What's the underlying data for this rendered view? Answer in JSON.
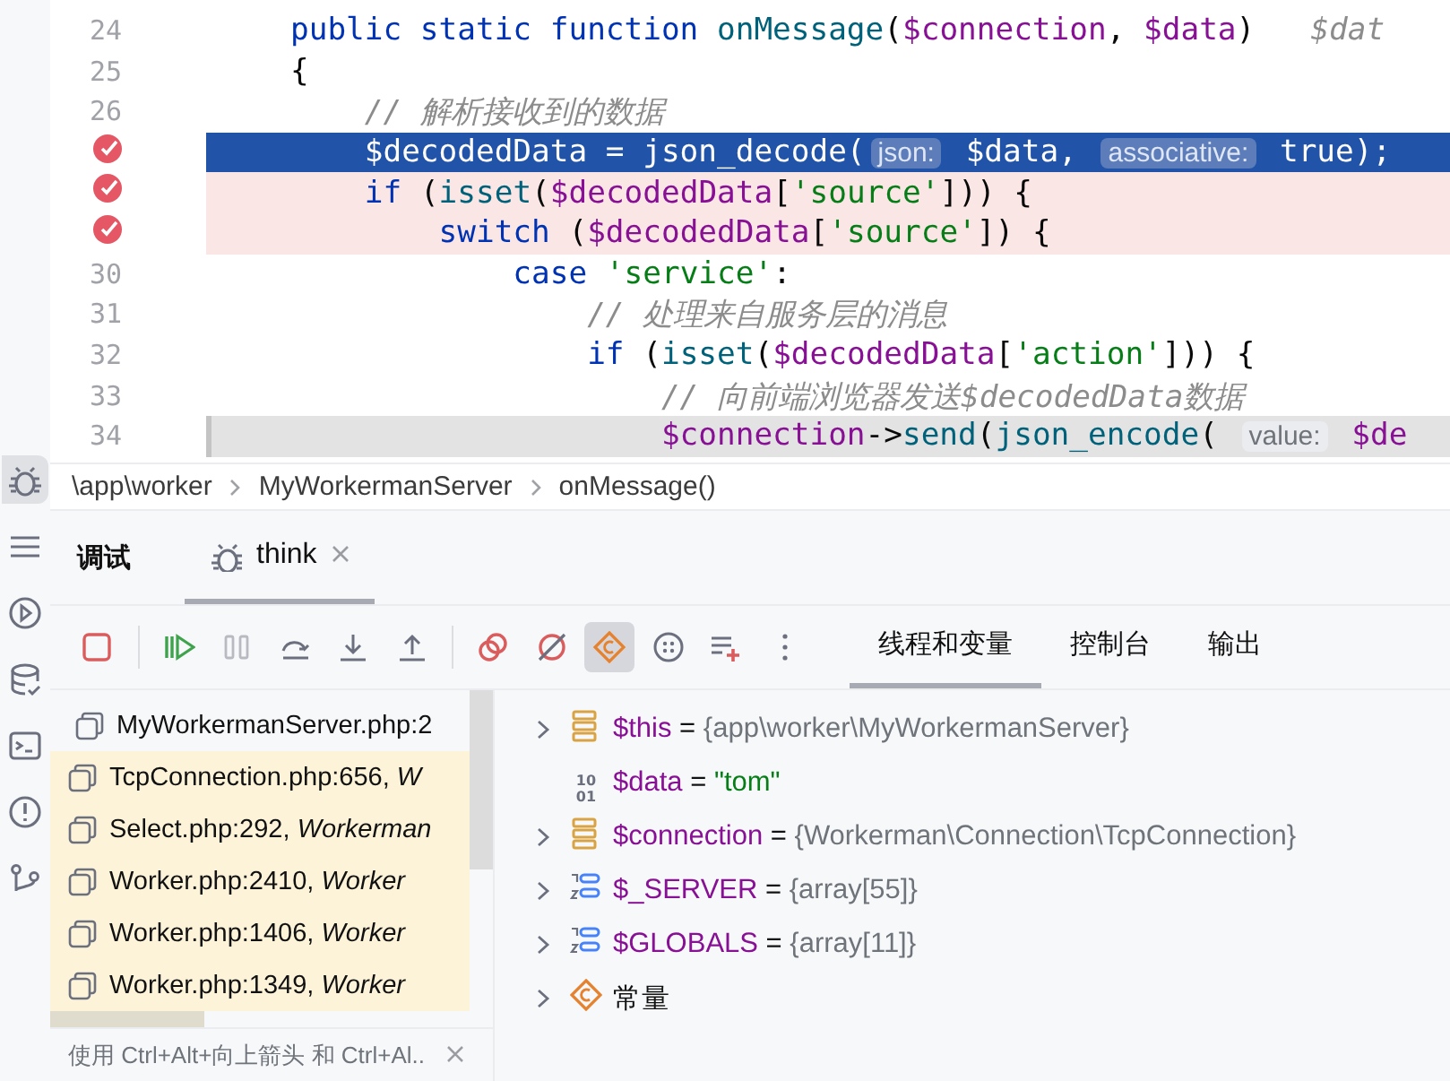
{
  "tool_strip": [
    {
      "kind": "debug",
      "selected": true
    },
    {
      "kind": "list",
      "selected": false
    },
    {
      "kind": "run",
      "selected": false
    },
    {
      "kind": "database",
      "selected": false
    },
    {
      "kind": "terminal",
      "selected": false
    },
    {
      "kind": "problems",
      "selected": false
    },
    {
      "kind": "git",
      "selected": false
    }
  ],
  "editor": {
    "lines": [
      {
        "number": "24",
        "breakpoint": false,
        "current": false,
        "frame": false,
        "tokens": [
          {
            "kind": "kw",
            "text": "public static function "
          },
          {
            "kind": "fn",
            "text": "onMessage"
          },
          {
            "kind": "plain",
            "text": "("
          },
          {
            "kind": "var",
            "text": "$connection"
          },
          {
            "kind": "plain",
            "text": ", "
          },
          {
            "kind": "var",
            "text": "$data"
          },
          {
            "kind": "plain",
            "text": ")   "
          },
          {
            "kind": "ghost",
            "text": "$dat"
          }
        ]
      },
      {
        "number": "25",
        "breakpoint": false,
        "current": false,
        "frame": false,
        "tokens": [
          {
            "kind": "plain",
            "text": "{"
          }
        ]
      },
      {
        "number": "26",
        "breakpoint": false,
        "current": false,
        "frame": false,
        "tokens": [
          {
            "kind": "comment",
            "text": "    // 解析接收到的数据"
          }
        ]
      },
      {
        "breakpoint": true,
        "current": true,
        "frame": false,
        "tokens": [
          {
            "kind": "plain",
            "text": "    $decodedData = json_decode("
          },
          {
            "kind": "hint",
            "text": "json:"
          },
          {
            "kind": "plain",
            "text": " $data, "
          },
          {
            "kind": "hint",
            "text": "associative:"
          },
          {
            "kind": "plain",
            "text": " true);"
          }
        ]
      },
      {
        "breakpoint": true,
        "current": false,
        "frame": false,
        "tokens": [
          {
            "kind": "kw",
            "text": "    if "
          },
          {
            "kind": "plain",
            "text": "("
          },
          {
            "kind": "fn",
            "text": "isset"
          },
          {
            "kind": "plain",
            "text": "("
          },
          {
            "kind": "var",
            "text": "$decodedData"
          },
          {
            "kind": "plain",
            "text": "["
          },
          {
            "kind": "str",
            "text": "'source'"
          },
          {
            "kind": "plain",
            "text": "])) {"
          }
        ]
      },
      {
        "breakpoint": true,
        "current": false,
        "frame": false,
        "tokens": [
          {
            "kind": "kw",
            "text": "        switch "
          },
          {
            "kind": "plain",
            "text": "("
          },
          {
            "kind": "var",
            "text": "$decodedData"
          },
          {
            "kind": "plain",
            "text": "["
          },
          {
            "kind": "str",
            "text": "'source'"
          },
          {
            "kind": "plain",
            "text": "]) {"
          }
        ]
      },
      {
        "number": "30",
        "breakpoint": false,
        "current": false,
        "frame": false,
        "tokens": [
          {
            "kind": "kw",
            "text": "            case "
          },
          {
            "kind": "str",
            "text": "'service'"
          },
          {
            "kind": "plain",
            "text": ":"
          }
        ]
      },
      {
        "number": "31",
        "breakpoint": false,
        "current": false,
        "frame": false,
        "tokens": [
          {
            "kind": "comment",
            "text": "                // 处理来自服务层的消息"
          }
        ]
      },
      {
        "number": "32",
        "breakpoint": false,
        "current": false,
        "frame": false,
        "tokens": [
          {
            "kind": "kw",
            "text": "                if "
          },
          {
            "kind": "plain",
            "text": "("
          },
          {
            "kind": "fn",
            "text": "isset"
          },
          {
            "kind": "plain",
            "text": "("
          },
          {
            "kind": "var",
            "text": "$decodedData"
          },
          {
            "kind": "plain",
            "text": "["
          },
          {
            "kind": "str",
            "text": "'action'"
          },
          {
            "kind": "plain",
            "text": "])) {"
          }
        ]
      },
      {
        "number": "33",
        "breakpoint": false,
        "current": false,
        "frame": false,
        "tokens": [
          {
            "kind": "comment",
            "text": "                    // 向前端浏览器发送$decodedData数据"
          }
        ]
      },
      {
        "number": "34",
        "breakpoint": false,
        "current": false,
        "frame": true,
        "tokens": [
          {
            "kind": "var",
            "text": "                    $connection"
          },
          {
            "kind": "plain",
            "text": "->"
          },
          {
            "kind": "fn",
            "text": "send"
          },
          {
            "kind": "plain",
            "text": "("
          },
          {
            "kind": "fn",
            "text": "json_encode"
          },
          {
            "kind": "plain",
            "text": "( "
          },
          {
            "kind": "hint",
            "text": "value:"
          },
          {
            "kind": "var",
            "text": " $de"
          }
        ]
      }
    ]
  },
  "breadcrumb": [
    "\\app\\worker",
    "MyWorkermanServer",
    "onMessage()"
  ],
  "debug": {
    "title": "调试",
    "session_tab": {
      "label": "think",
      "selected": true
    },
    "toolbar": [
      {
        "kind": "stop",
        "disabled": false,
        "selected": false
      },
      {
        "kind": "resume",
        "disabled": false,
        "selected": false
      },
      {
        "kind": "pause",
        "disabled": true,
        "selected": false
      },
      {
        "kind": "step-over",
        "disabled": false,
        "selected": false
      },
      {
        "kind": "step-into",
        "disabled": false,
        "selected": false
      },
      {
        "kind": "step-out",
        "disabled": false,
        "selected": false
      },
      {
        "kind": "breakpoints",
        "disabled": false,
        "selected": false
      },
      {
        "kind": "mute",
        "disabled": false,
        "selected": false
      },
      {
        "kind": "constants",
        "disabled": false,
        "selected": true
      },
      {
        "kind": "more",
        "disabled": false,
        "selected": false
      },
      {
        "kind": "add-watch",
        "disabled": false,
        "selected": false
      },
      {
        "kind": "menu",
        "disabled": false,
        "selected": false
      }
    ],
    "view_tabs": [
      {
        "label": "线程和变量",
        "selected": true
      },
      {
        "label": "控制台",
        "selected": false
      },
      {
        "label": "输出",
        "selected": false
      }
    ],
    "frames": [
      {
        "text": "MyWorkermanServer.php:2",
        "selected": true,
        "library": false
      },
      {
        "text": "TcpConnection.php:656, *W*",
        "selected": false,
        "library": true
      },
      {
        "text": "Select.php:292, *Workerman*",
        "selected": false,
        "library": true
      },
      {
        "text": "Worker.php:2410, *Worker*",
        "selected": false,
        "library": true
      },
      {
        "text": "Worker.php:1406, *Worker*",
        "selected": false,
        "library": true
      },
      {
        "text": "Worker.php:1349, *Worker*",
        "selected": false,
        "library": true
      }
    ],
    "hint": "使用 Ctrl+Alt+向上箭头 和 Ctrl+Al..",
    "variables": [
      {
        "kind": "object",
        "expandable": true,
        "name": "$this",
        "operator": "=",
        "value": {
          "kind": "object",
          "text": "{app\\worker\\MyWorkermanServer}"
        }
      },
      {
        "kind": "scalar",
        "expandable": false,
        "type_label": [
          "10",
          "01"
        ],
        "name": "$data",
        "operator": "=",
        "value": {
          "kind": "string",
          "text": "\"tom\""
        }
      },
      {
        "kind": "object",
        "expandable": true,
        "name": "$connection",
        "operator": "=",
        "value": {
          "kind": "object",
          "text": "{Workerman\\Connection\\TcpConnection}"
        }
      },
      {
        "kind": "array",
        "expandable": true,
        "name": "$_SERVER",
        "operator": "=",
        "value": {
          "kind": "object",
          "text": "{array[55]}"
        }
      },
      {
        "kind": "array",
        "expandable": true,
        "name": "$GLOBALS",
        "operator": "=",
        "value": {
          "kind": "object",
          "text": "{array[11]}"
        }
      },
      {
        "kind": "constant",
        "expandable": true,
        "name": "常量"
      }
    ]
  }
}
